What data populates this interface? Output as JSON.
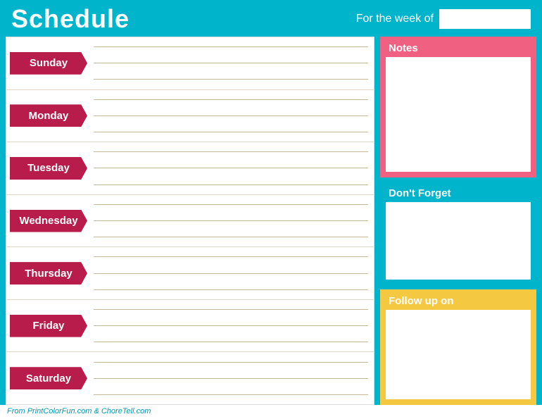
{
  "header": {
    "title": "Schedule",
    "week_label": "For the week of",
    "week_value": ""
  },
  "days": [
    {
      "id": "sunday",
      "label": "Sunday",
      "lines": 3
    },
    {
      "id": "monday",
      "label": "Monday",
      "lines": 3
    },
    {
      "id": "tuesday",
      "label": "Tuesday",
      "lines": 3
    },
    {
      "id": "wednesday",
      "label": "Wednesday",
      "lines": 3
    },
    {
      "id": "thursday",
      "label": "Thursday",
      "lines": 3
    },
    {
      "id": "friday",
      "label": "Friday",
      "lines": 3
    },
    {
      "id": "saturday",
      "label": "Saturday",
      "lines": 3
    }
  ],
  "panels": {
    "notes": {
      "title": "Notes"
    },
    "dont_forget": {
      "title": "Don't Forget"
    },
    "follow_up": {
      "title": "Follow up on"
    }
  },
  "footer": {
    "text": "From PrintColorFun.com & ChoreTell.com"
  },
  "colors": {
    "bg": "#00b4cc",
    "day_banner": "#b71c4a",
    "panel_notes": "#f06080",
    "panel_dont_forget": "#00b4cc",
    "panel_follow_up": "#f5c842",
    "line_color": "#c8b89a"
  }
}
